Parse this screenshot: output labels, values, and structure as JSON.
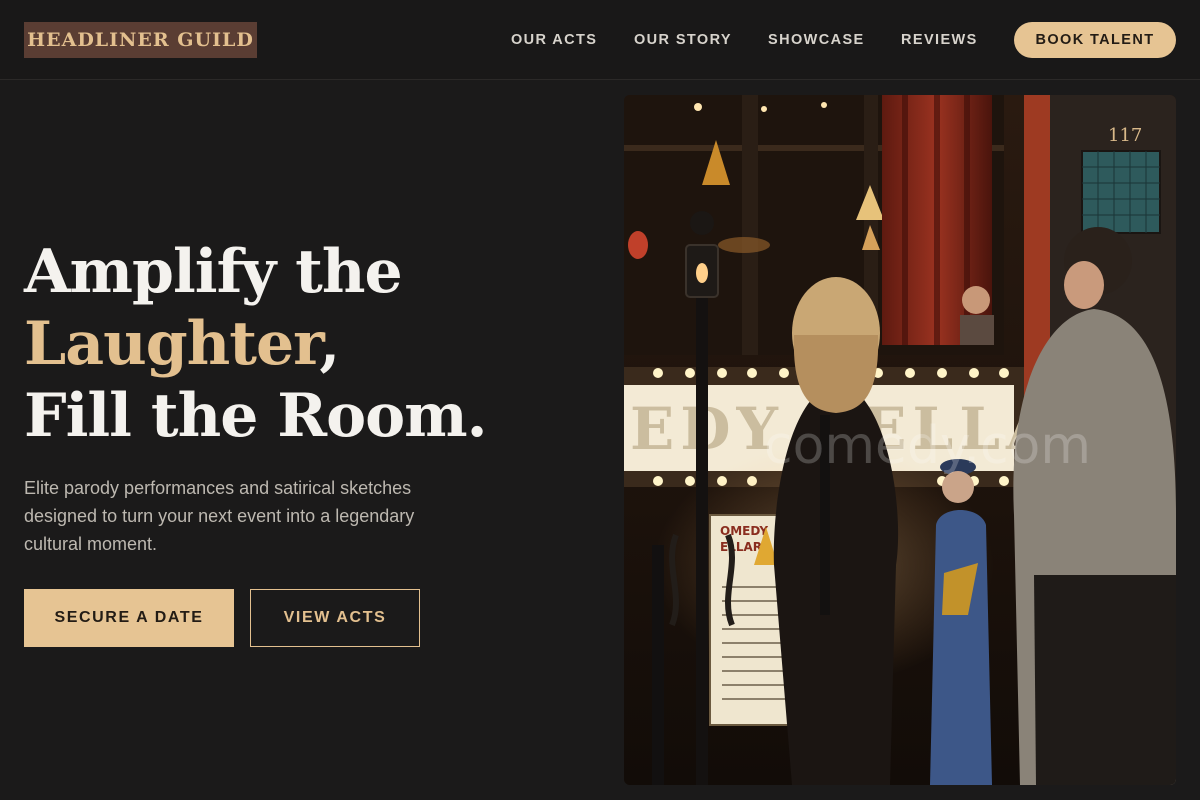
{
  "brand": {
    "name": "HEADLINER GUILD"
  },
  "nav": {
    "items": [
      {
        "label": "OUR ACTS"
      },
      {
        "label": "OUR STORY"
      },
      {
        "label": "SHOWCASE"
      },
      {
        "label": "REVIEWS"
      }
    ],
    "cta_label": "BOOK TALENT"
  },
  "hero": {
    "title_line1": "Amplify the",
    "title_accent": "Laughter",
    "title_comma": ",",
    "title_line3": "Fill the Room.",
    "description": "Elite parody performances and satirical sketches designed to turn your next event into a legendary cultural moment.",
    "primary_button": "SECURE A DATE",
    "secondary_button": "VIEW ACTS",
    "image": {
      "icon": "comedy-club-photo",
      "marquee_text": "EDY CELLAR",
      "door_number": "117",
      "poster_lines": [
        "OMEDY",
        "ELLAR"
      ],
      "watermark": "comedy.com"
    }
  },
  "colors": {
    "background": "#1b1a1a",
    "accent": "#e3c08f",
    "button_fill": "#e6c493",
    "logo_bg": "#5a3d33",
    "body_text": "#bdb8b0"
  }
}
